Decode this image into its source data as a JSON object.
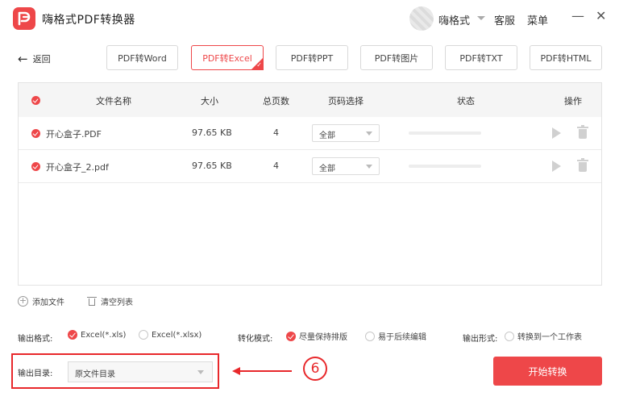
{
  "app": {
    "title": "嗨格式PDF转换器",
    "logo_icon": "pdf-logo-icon"
  },
  "titlebar": {
    "username": "嗨格式",
    "service": "客服",
    "menu": "菜单",
    "minimize": "—",
    "close": "✕"
  },
  "back": {
    "label": "返回"
  },
  "format_tabs": [
    {
      "label": "PDF转Word"
    },
    {
      "label": "PDF转Excel",
      "active": true
    },
    {
      "label": "PDF转PPT"
    },
    {
      "label": "PDF转图片"
    },
    {
      "label": "PDF转TXT"
    },
    {
      "label": "PDF转HTML"
    }
  ],
  "table": {
    "headers": {
      "name": "文件名称",
      "size": "大小",
      "pages": "总页数",
      "page_select": "页码选择",
      "status": "状态",
      "action": "操作"
    },
    "rows": [
      {
        "name": "开心盒子.PDF",
        "size": "97.65 KB",
        "pages": "4",
        "page_select": "全部"
      },
      {
        "name": "开心盒子_2.pdf",
        "size": "97.65 KB",
        "pages": "4",
        "page_select": "全部"
      }
    ]
  },
  "actions": {
    "add_file": "添加文件",
    "clear_list": "清空列表"
  },
  "options": {
    "output_format": {
      "label": "输出格式:",
      "opt1": "Excel(*.xls)",
      "opt2": "Excel(*.xlsx)",
      "selected": "Excel(*.xls)"
    },
    "convert_mode": {
      "label": "转化模式:",
      "opt1": "尽量保持排版",
      "opt2": "易于后续编辑",
      "selected": "尽量保持排版"
    },
    "output_form": {
      "label": "输出形式:",
      "opt1": "转换到一个工作表"
    }
  },
  "output_dir": {
    "label": "输出目录:",
    "value": "原文件目录"
  },
  "annotation": {
    "step": "⑥"
  },
  "start_button": "开始转换",
  "colors": {
    "accent": "#ee4749",
    "highlight": "#e8282b"
  }
}
